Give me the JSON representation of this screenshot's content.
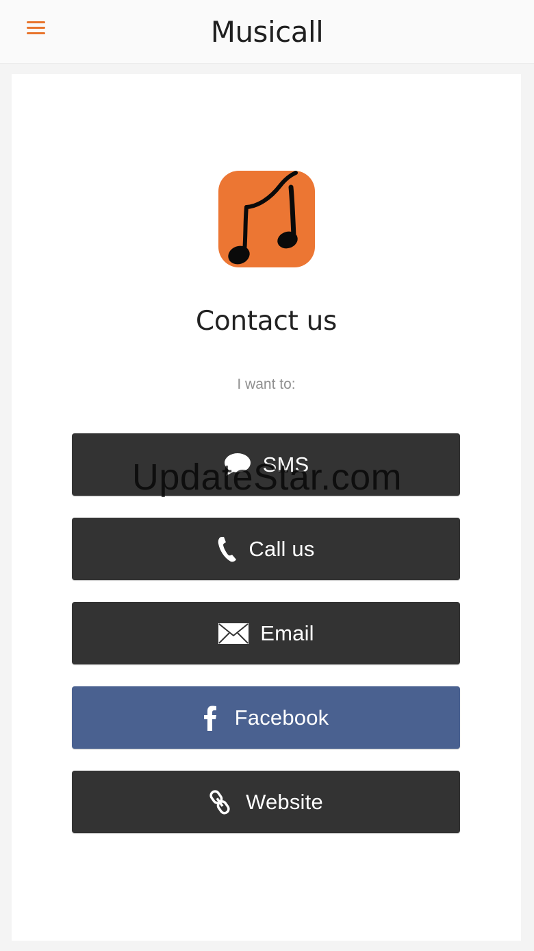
{
  "header": {
    "title": "Musicall",
    "menu_icon": "hamburger-menu-icon",
    "accent_color": "#e8742c"
  },
  "content": {
    "logo_icon": "music-notes-icon",
    "logo_color": "#ec7633",
    "heading": "Contact us",
    "subheading": "I want to:"
  },
  "actions": [
    {
      "label": "SMS",
      "icon": "speech-bubble-icon",
      "color": "#333333"
    },
    {
      "label": "Call us",
      "icon": "phone-icon",
      "color": "#333333"
    },
    {
      "label": "Email",
      "icon": "envelope-icon",
      "color": "#333333"
    },
    {
      "label": "Facebook",
      "icon": "facebook-icon",
      "color": "#4a6190"
    },
    {
      "label": "Website",
      "icon": "link-icon",
      "color": "#333333"
    }
  ],
  "watermark": "UpdateStar.com"
}
